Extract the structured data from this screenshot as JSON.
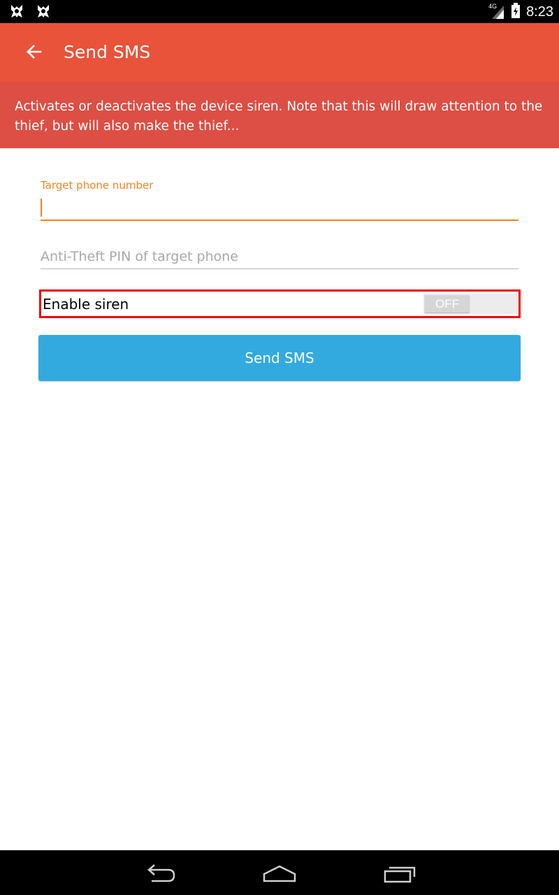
{
  "status_bar": {
    "network": "4G",
    "time": "8:23",
    "notification_icons": [
      "avast-icon",
      "avast-icon"
    ]
  },
  "app_bar": {
    "title": "Send SMS",
    "back_icon": "arrow-left-icon"
  },
  "banner": {
    "text": "Activates or deactivates the device siren. Note that this will draw attention to the thief, but will also make the thief..."
  },
  "form": {
    "phone": {
      "label": "Target phone number",
      "value": ""
    },
    "pin": {
      "placeholder": "Anti-Theft PIN of target phone",
      "value": ""
    },
    "siren": {
      "label": "Enable siren",
      "toggle_text": "OFF",
      "enabled": false
    },
    "submit_label": "Send SMS"
  },
  "nav_bar": {
    "buttons": [
      "back-icon",
      "home-icon",
      "recents-icon"
    ]
  },
  "colors": {
    "app_bar": "#e8533a",
    "banner": "#dd4e44",
    "accent": "#f5821f",
    "button": "#33aadf",
    "highlight": "#ee0000"
  }
}
